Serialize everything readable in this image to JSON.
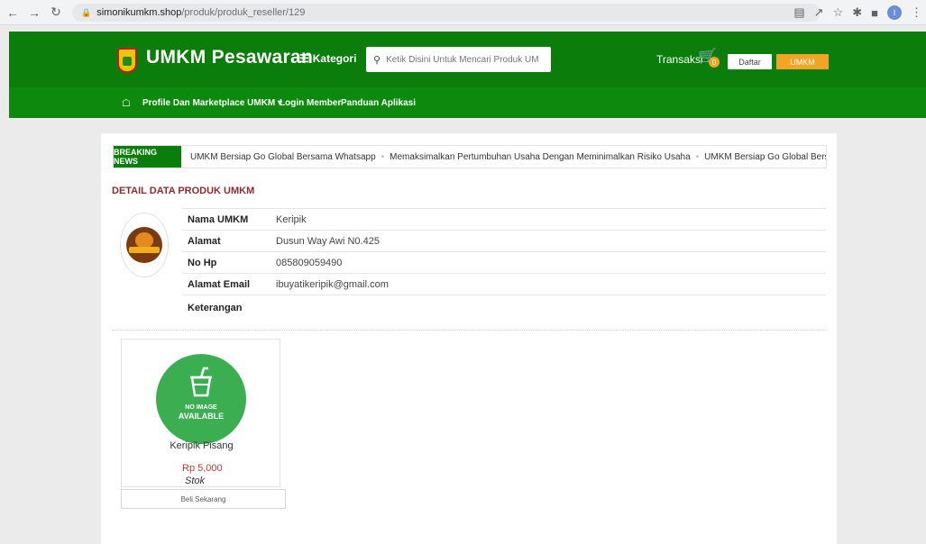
{
  "browser": {
    "url_host": "simonikumkm.shop",
    "url_path": "/produk/produk_reseller/129",
    "profile_initial": "I"
  },
  "header": {
    "brand": "UMKM Pesawaran",
    "kategori_label": "Kategori",
    "search_placeholder": "Ketik Disini Untuk Mencari Produk UMKM...",
    "transaksi_label": "Transaksi",
    "cart_count": "0",
    "daftar_label": "Daftar",
    "umkm_label": "UMKM"
  },
  "nav": {
    "items": [
      {
        "label": "Profile Dan Marketplace UMKM ▾"
      },
      {
        "label": "Login Member"
      },
      {
        "label": "Panduan Aplikasi"
      }
    ]
  },
  "breaking": {
    "label": "BREAKING NEWS",
    "items": [
      "UMKM Bersiap Go Global Bersama Whatsapp",
      "Memaksimalkan Pertumbuhan Usaha Dengan Meminimalkan Risiko Usaha",
      "UMKM Bersiap Go Global Bersama Whatsapp"
    ]
  },
  "detail": {
    "title": "DETAIL DATA PRODUK UMKM",
    "rows": [
      {
        "label": "Nama UMKM",
        "value": "Keripik"
      },
      {
        "label": "Alamat",
        "value": "Dusun Way Awi N0.425"
      },
      {
        "label": "No Hp",
        "value": "085809059490"
      },
      {
        "label": "Alamat Email",
        "value": "ibuyatikeripik@gmail.com"
      },
      {
        "label": "Keterangan",
        "value": ""
      }
    ]
  },
  "product": {
    "no_image_line1": "NO IMAGE",
    "no_image_line2": "AVAILABLE",
    "name": "Keripik Pisang",
    "price": "Rp 5,000",
    "stok_label": "Stok",
    "buy_label": "Beli Sekarang"
  },
  "colors": {
    "header_green": "#0a7d0a",
    "accent_orange": "#f4a425",
    "title_red": "#8b2c2c",
    "price_red": "#c0392b",
    "noimage_green": "#3cae52"
  }
}
